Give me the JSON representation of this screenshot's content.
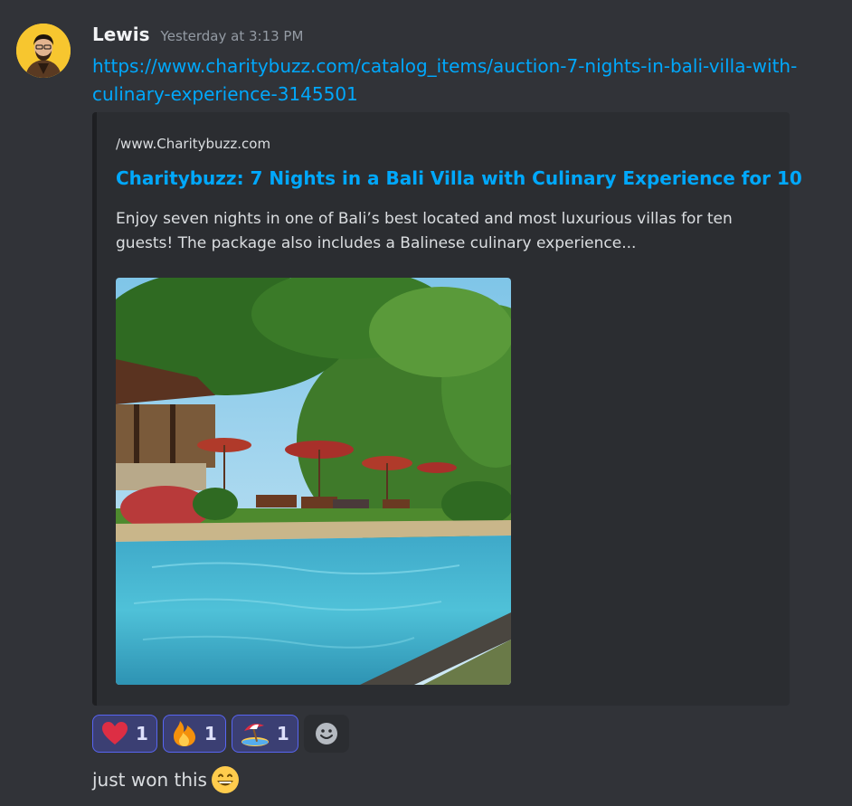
{
  "message": {
    "username": "Lewis",
    "timestamp": "Yesterday at 3:13 PM",
    "link": "https://www.charitybuzz.com/catalog_items/auction-7-nights-in-bali-villa-with-culinary-experience-3145501",
    "body": "just won this",
    "body_emoji": "grinning-face-icon"
  },
  "embed": {
    "provider": "/www.Charitybuzz.com",
    "title": "Charitybuzz: 7 Nights in a Bali Villa with Culinary Experience for 10",
    "description": "Enjoy seven nights in one of Bali’s best located and most luxurious villas for ten guests! The package also includes a Balinese culinary experience..."
  },
  "reactions": [
    {
      "icon": "heart-icon",
      "count": "1"
    },
    {
      "icon": "fire-icon",
      "count": "1"
    },
    {
      "icon": "beach-umbrella-icon",
      "count": "1"
    }
  ],
  "colors": {
    "background": "#313338",
    "embed_bg": "#2b2d31",
    "link": "#00a8fc",
    "reaction_border": "#5865f2",
    "reaction_bg": "#3b3f73"
  }
}
